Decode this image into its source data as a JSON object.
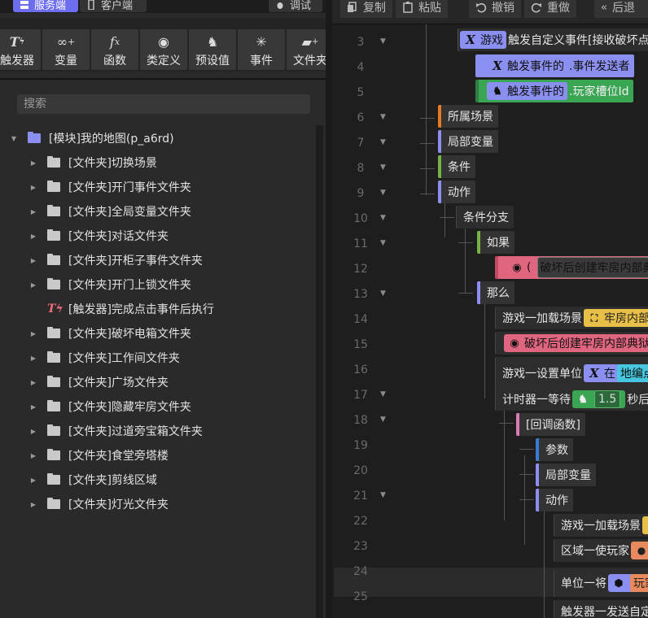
{
  "left": {
    "mode_tabs": {
      "server": "服务端",
      "client": "客户端",
      "debug": "调试"
    },
    "tools": [
      {
        "icon": "trigger-icon",
        "glyph": "T",
        "label": "触发器"
      },
      {
        "icon": "variable-icon",
        "glyph": "∞",
        "label": "变量"
      },
      {
        "icon": "function-icon",
        "glyph": "fx",
        "label": "函数"
      },
      {
        "icon": "class-icon",
        "glyph": "◎",
        "label": "类定义"
      },
      {
        "icon": "preset-icon",
        "glyph": "⚙",
        "label": "预设值"
      },
      {
        "icon": "event-icon",
        "glyph": "✳",
        "label": "事件"
      },
      {
        "icon": "folder-add-icon",
        "glyph": "▣",
        "label": "文件夹"
      }
    ],
    "search_placeholder": "搜索",
    "tree": {
      "root": "[模块]我的地图(p_a6rd)",
      "items": [
        {
          "type": "folder",
          "label": "[文件夹]切换场景"
        },
        {
          "type": "folder",
          "label": "[文件夹]开门事件文件夹"
        },
        {
          "type": "folder",
          "label": "[文件夹]全局变量文件夹"
        },
        {
          "type": "folder",
          "label": "[文件夹]对话文件夹"
        },
        {
          "type": "folder",
          "label": "[文件夹]开柜子事件文件夹"
        },
        {
          "type": "folder",
          "label": "[文件夹]开门上锁文件夹"
        },
        {
          "type": "trigger",
          "label": "[触发器]完成点击事件后执行"
        },
        {
          "type": "folder",
          "label": "[文件夹]破坏电箱文件夹"
        },
        {
          "type": "folder",
          "label": "[文件夹]工作间文件夹"
        },
        {
          "type": "folder",
          "label": "[文件夹]广场文件夹"
        },
        {
          "type": "folder",
          "label": "[文件夹]隐藏牢房文件夹"
        },
        {
          "type": "folder",
          "label": "[文件夹]过道旁宝箱文件夹"
        },
        {
          "type": "folder",
          "label": "[文件夹]食堂旁塔楼"
        },
        {
          "type": "folder",
          "label": "[文件夹]剪线区域"
        },
        {
          "type": "folder",
          "label": "[文件夹]灯光文件夹"
        }
      ]
    }
  },
  "right": {
    "toolbar": {
      "copy": "复制",
      "paste": "粘贴",
      "undo": "撤销",
      "redo": "重做",
      "back": "后退"
    },
    "lines": [
      "3",
      "4",
      "5",
      "6",
      "7",
      "8",
      "9",
      "10",
      "11",
      "12",
      "13",
      "14",
      "15",
      "16",
      "17",
      "18",
      "19",
      "20",
      "21",
      "22",
      "23",
      "24",
      "25"
    ],
    "code": {
      "l3_chip": "游戏",
      "l3_text": "触发自定义事件[接收破坏点",
      "l4_chip": "触发事件的",
      "l4_text": ".事件发送者",
      "l5_chip": "触发事件的",
      "l5_text": ".玩家槽位Id",
      "l6": "所属场景",
      "l7": "局部变量",
      "l8": "条件",
      "l9": "动作",
      "l10": "条件分支",
      "l11": "如果",
      "l12_paren": "(",
      "l12_text": "破坏后创建牢房内部典狱",
      "l13": "那么",
      "l14_text": "游戏一加载场景",
      "l14_chip": "牢房内部",
      "l15_text": "破坏后创建牢房内部典狱",
      "l16_text": "游戏一设置单位",
      "l16_in": "在",
      "l16_chip": "地编点",
      "l17_text": "计时器一等待",
      "l17_val": "1.5",
      "l17_suffix": "秒后执",
      "l18": "[回调函数]",
      "l19": "参数",
      "l20": "局部变量",
      "l21": "动作",
      "l22": "游戏一加载场景",
      "l23": "区域一使玩家",
      "l24_text": "单位一将",
      "l24_chip": "玩家",
      "l25": "触发器一发送自定"
    }
  }
}
